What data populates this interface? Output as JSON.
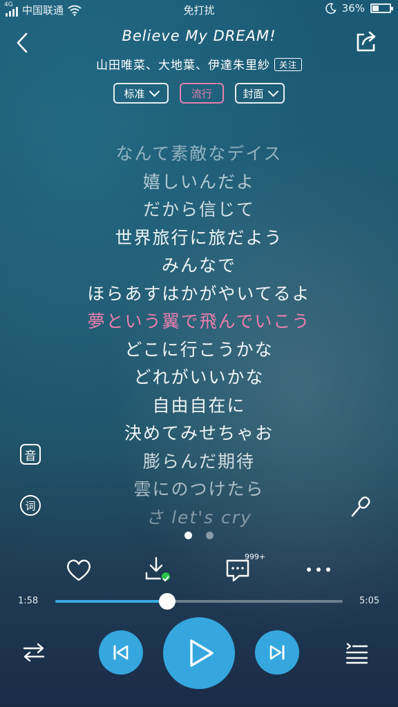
{
  "status": {
    "network": "4G",
    "carrier": "中国联通",
    "center_text": "免打扰",
    "battery_text": "36%",
    "battery_level": 0.36,
    "icons": [
      "signal-icon",
      "wifi-icon",
      "moon-icon",
      "battery-icon"
    ]
  },
  "header": {
    "song_title": "Believe My DREAM!",
    "artists": "山田唯菜、大地葉、伊達朱里紗",
    "follow_label": "关注"
  },
  "chips": [
    {
      "label": "标准",
      "has_dropdown": true,
      "active": false
    },
    {
      "label": "流行",
      "has_dropdown": false,
      "active": true
    },
    {
      "label": "封面",
      "has_dropdown": true,
      "active": false
    }
  ],
  "lyrics": {
    "lines": [
      "なんて素敵なデイス",
      "嬉しいんだよ",
      "だから信じて",
      "世界旅行に旅だよう",
      "みんなで",
      "ほらあすはかがやいてるよ",
      "夢という翼で飛んでいこう",
      "どこに行こうかな",
      "どれがいいかな",
      "自由自在に",
      "決めてみせちゃお",
      "膨らんだ期待",
      "雲にのつけたら",
      "さ let's cry"
    ],
    "current_index": 6,
    "highlight_color": "#eb7fae"
  },
  "side": {
    "sound_label": "音",
    "lyric_label": "词"
  },
  "pager": {
    "count": 2,
    "active": 0
  },
  "actions": {
    "comment_count": "999+"
  },
  "progress": {
    "elapsed": "1:58",
    "total": "5:05",
    "fraction": 0.39,
    "accent": "#3aa9df"
  },
  "controls": {
    "accent": "#35a7de"
  }
}
